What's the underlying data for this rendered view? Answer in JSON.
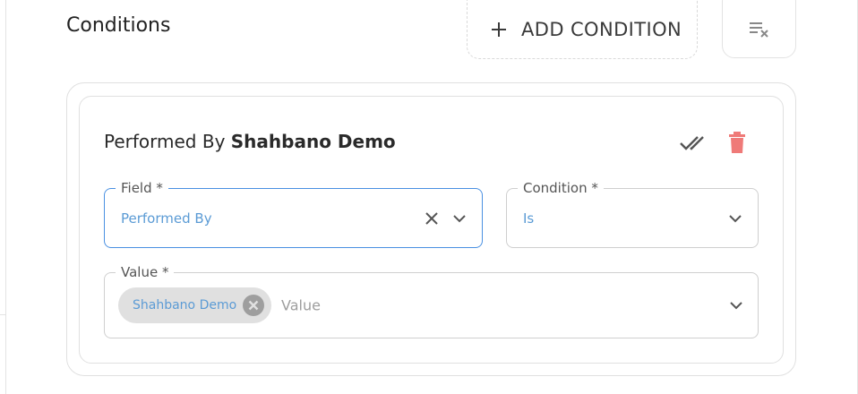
{
  "section": {
    "title": "Conditions"
  },
  "toolbar": {
    "add_condition_label": "ADD CONDITION",
    "add_icon": "plus-icon",
    "clear_icon": "clear-all-icon"
  },
  "condition": {
    "title_prefix": "Performed By",
    "title_value": "Shahbano Demo",
    "apply_icon": "double-check-icon",
    "delete_icon": "trash-icon",
    "field": {
      "label": "Field *",
      "value": "Performed By"
    },
    "operator": {
      "label": "Condition *",
      "value": "Is"
    },
    "value": {
      "label": "Value *",
      "chip": "Shahbano Demo",
      "placeholder": "Value"
    }
  },
  "colors": {
    "accent": "#4a90e2",
    "value_text": "#5b9bd5",
    "delete": "#ef7a78",
    "chip_bg": "#e0e0e0"
  }
}
